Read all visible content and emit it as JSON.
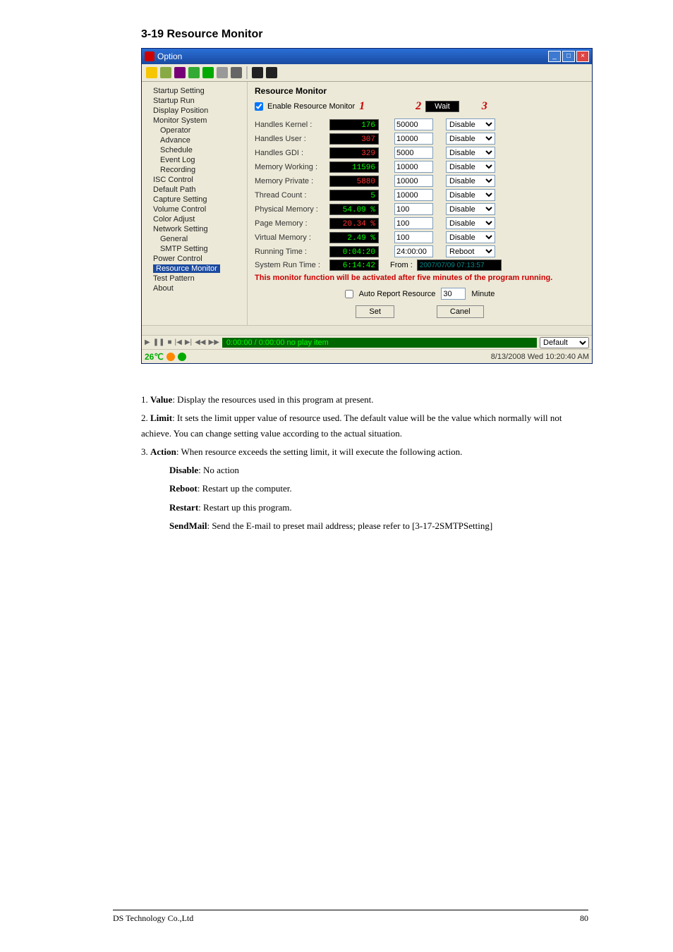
{
  "section_title": "3-19 Resource Monitor",
  "window": {
    "title": "Option",
    "toolbar_icons": [
      "radiation",
      "brown",
      "purple",
      "green",
      "green2",
      "gray",
      "dkgray",
      "sep",
      "black",
      "black2"
    ]
  },
  "tree": {
    "items": [
      {
        "label": "Startup Setting"
      },
      {
        "label": "Startup Run"
      },
      {
        "label": "Display Position"
      },
      {
        "label": "Monitor System",
        "children": [
          "Operator",
          "Advance",
          "Schedule",
          "Event Log",
          "Recording"
        ]
      },
      {
        "label": "ISC Control"
      },
      {
        "label": "Default Path"
      },
      {
        "label": "Capture Setting"
      },
      {
        "label": "Volume Control"
      },
      {
        "label": "Color Adjust"
      },
      {
        "label": "Network Setting",
        "children": [
          "General",
          "SMTP Setting"
        ]
      },
      {
        "label": "Power Control"
      },
      {
        "label": "Resource Monitor",
        "selected": true
      },
      {
        "label": "Test Pattern"
      },
      {
        "label": "About"
      }
    ]
  },
  "monitor": {
    "title": "Resource Monitor",
    "enable_label": "Enable Resource Monitor",
    "enable_checked": true,
    "annot1": "1",
    "annot2": "2",
    "annot3": "3",
    "wait_label": "Wait",
    "rows": [
      {
        "label": "Handles Kernel :",
        "val": "176",
        "lim": "50000",
        "act": "Disable"
      },
      {
        "label": "Handles User :",
        "val": "307",
        "red": true,
        "lim": "10000",
        "act": "Disable"
      },
      {
        "label": "Handles GDI :",
        "val": "329",
        "red": true,
        "lim": "5000",
        "act": "Disable"
      },
      {
        "label": "Memory Working :",
        "val": "11596",
        "lim": "10000",
        "act": "Disable"
      },
      {
        "label": "Memory Private :",
        "val": "5880",
        "red": true,
        "lim": "10000",
        "act": "Disable"
      },
      {
        "label": "Thread Count :",
        "val": "5",
        "lim": "10000",
        "act": "Disable"
      },
      {
        "label": "Physical Memory :",
        "val": "54.09 %",
        "lim": "100",
        "act": "Disable"
      },
      {
        "label": "Page Memory :",
        "val": "20.34 %",
        "red": true,
        "lim": "100",
        "act": "Disable"
      },
      {
        "label": "Virtual Memory :",
        "val": "2.49 %",
        "lim": "100",
        "act": "Disable"
      },
      {
        "label": "Running Time :",
        "val": "0:04:20",
        "lim": "24:00:00",
        "act": "Reboot"
      }
    ],
    "system_run_label": "System Run Time :",
    "system_run_val": "6:14:42",
    "from_label": "From :",
    "from_val": "2007/07/09 07:13:57",
    "warn": "This monitor function will be activated after five minutes of the program running.",
    "auto_label": "Auto Report Resource",
    "auto_val": "30",
    "auto_unit": "Minute",
    "set_btn": "Set",
    "cancel_btn": "Canel"
  },
  "playbar": {
    "time": "0:00:00 / 0:00:00  no play item",
    "profile": "Default"
  },
  "statusbar": {
    "temp": "26℃",
    "datetime": "8/13/2008 Wed 10:20:40 AM"
  },
  "desc": {
    "items": [
      {
        "n": "1.",
        "b": "Value",
        "t": ": Display the resources used in this program at present."
      },
      {
        "n": "2.",
        "b": "Limit",
        "t": ": It sets the limit upper value of resource used. The default value will be the value which normally will not achieve. You can change setting value according to the actual situation."
      },
      {
        "n": "3.",
        "b": "Action",
        "t": ": When resource exceeds the setting limit, it will execute the following action."
      },
      {
        "sub": true,
        "b": "Disable",
        "t": ": No action"
      },
      {
        "sub": true,
        "b": "Reboot",
        "t": ": Restart up the computer."
      },
      {
        "sub": true,
        "b": "Restart",
        "t": ": Restart up this program."
      },
      {
        "sub": true,
        "b": "SendMail",
        "t": ": Send the E-mail to preset mail address; please refer to [3-17-2SMTPSetting]"
      }
    ]
  },
  "footer": {
    "left": "DS Technology Co.,Ltd",
    "right": "80"
  }
}
